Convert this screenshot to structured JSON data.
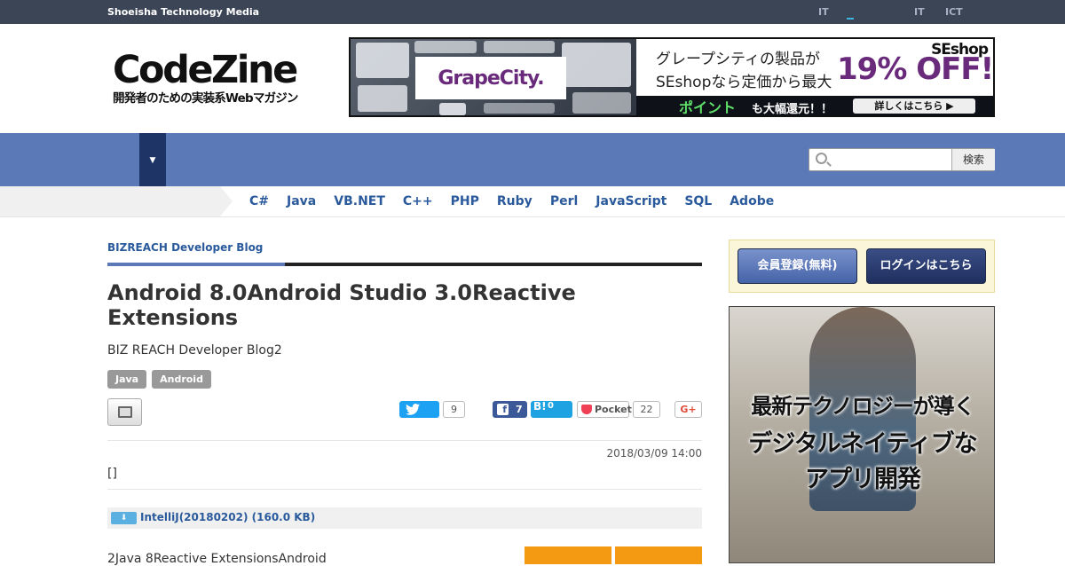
{
  "topbar": {
    "brand": "Shoeisha Technology Media",
    "links": [
      "IT",
      "IT",
      "ICT"
    ]
  },
  "logo": {
    "name": "CodeZine",
    "tagline": "開発者のための実装系Webマガジン"
  },
  "ad": {
    "brand": "GrapeCity.",
    "line1": "グレープシティの製品が",
    "line2": "SEshopなら定価から最大",
    "discount": "19% OFF!",
    "shop": "SEshop",
    "point": "ポイント",
    "point_suffix": "も大幅還元！！",
    "detail": "詳しくはこちら ▶"
  },
  "nav": {
    "dropdown_icon": "▼"
  },
  "search": {
    "placeholder": "",
    "button": "検索"
  },
  "languages": [
    "C#",
    "Java",
    "VB.NET",
    "C++",
    "PHP",
    "Ruby",
    "Perl",
    "JavaScript",
    "SQL",
    "Adobe"
  ],
  "article": {
    "category": "BIZREACH Developer Blog",
    "title": "Android 8.0Android Studio 3.0Reactive Extensions",
    "lead": "BIZ REACH Developer Blog2",
    "tags": [
      "Java",
      "Android"
    ],
    "date": "2018/03/09 14:00",
    "bracket": "[]",
    "download": "IntelliJ(20180202) (160.0 KB)",
    "body": "2Java 8Reactive ExtensionsAndroid"
  },
  "social": {
    "twitter_count": "9",
    "facebook_count": "7",
    "hatena_label": "B!",
    "hatena_count": "0",
    "pocket_label": "Pocket",
    "pocket_count": "22",
    "gplus_label": "G+"
  },
  "sidebar": {
    "register": "会員登録(無料)",
    "login": "ログインはこちら",
    "banner_line1": "最新テクノロジーが導く",
    "banner_line2": "デジタルネイティブな",
    "banner_line3": "アプリ開発"
  },
  "colors": {
    "nav_blue": "#5a79b6",
    "topbar": "#3b4556",
    "link_blue": "#2a5a9c"
  }
}
